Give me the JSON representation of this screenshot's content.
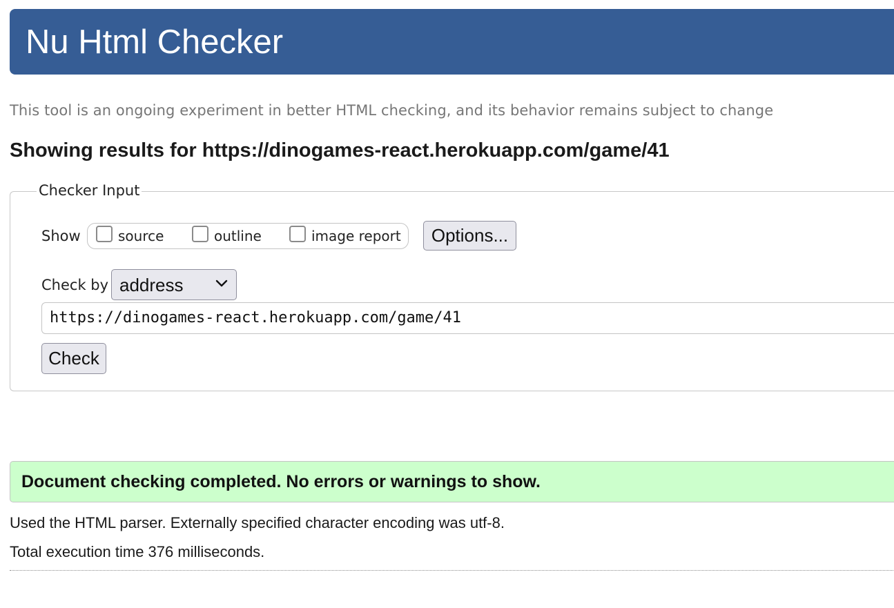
{
  "header": {
    "title": "Nu Html Checker"
  },
  "intro": {
    "text": "This tool is an ongoing experiment in better HTML checking, and its behavior remains subject to change"
  },
  "results": {
    "heading": "Showing results for https://dinogames-react.herokuapp.com/game/41"
  },
  "checker_input": {
    "legend": "Checker Input",
    "show_label": "Show",
    "options": [
      {
        "label": "source",
        "checked": false
      },
      {
        "label": "outline",
        "checked": false
      },
      {
        "label": "image report",
        "checked": false
      }
    ],
    "options_button": "Options...",
    "check_by_label": "Check by",
    "check_by_value": "address",
    "url_value": "https://dinogames-react.herokuapp.com/game/41",
    "check_button": "Check"
  },
  "status": {
    "message": "Document checking completed. No errors or warnings to show.",
    "parser_info": "Used the HTML parser. Externally specified character encoding was utf-8.",
    "execution_time": "Total execution time 376 milliseconds."
  },
  "colors": {
    "header_bg": "#365d95",
    "success_bg": "#ccffcc",
    "intro_text": "#767676"
  }
}
